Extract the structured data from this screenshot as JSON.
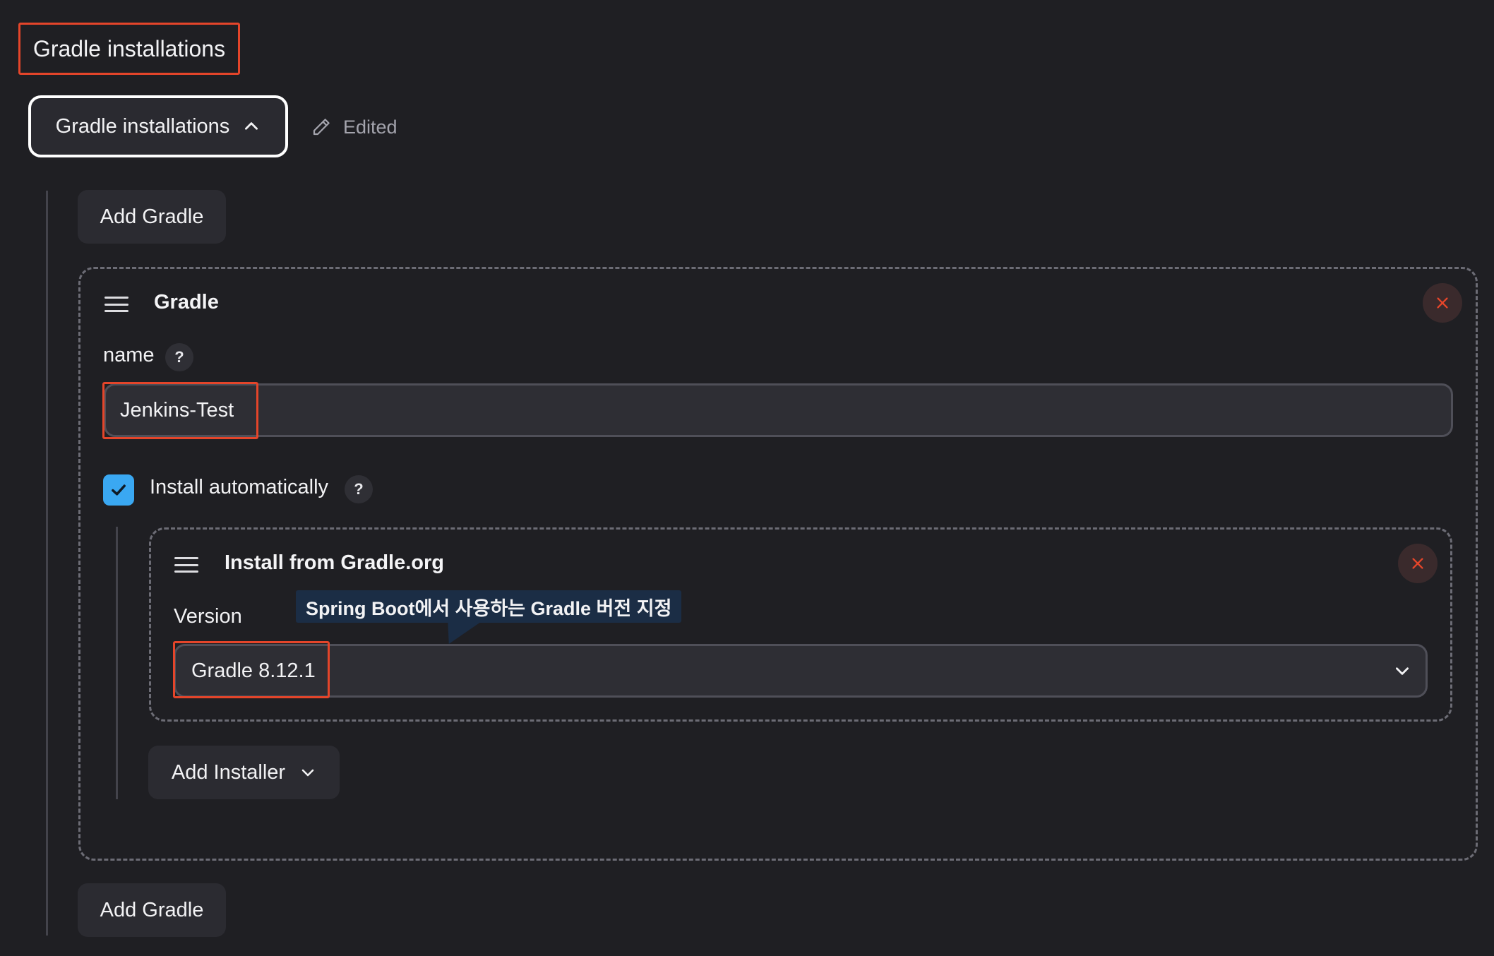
{
  "section": {
    "title": "Gradle installations"
  },
  "toggle": {
    "label": "Gradle installations",
    "icon": "chevron-up-icon"
  },
  "status": {
    "edited_label": "Edited",
    "icon": "pencil-icon"
  },
  "buttons": {
    "add_gradle_top": "Add Gradle",
    "add_gradle_bottom": "Add Gradle",
    "add_installer": "Add Installer"
  },
  "gradle_card": {
    "title": "Gradle",
    "name_label": "name",
    "name_help": "?",
    "name_value": "Jenkins-Test",
    "auto_install_label": "Install automatically",
    "auto_install_help": "?",
    "auto_install_checked": true
  },
  "installer_card": {
    "title": "Install from Gradle.org",
    "version_label": "Version",
    "version_value": "Gradle 8.12.1",
    "tooltip": "Spring Boot에서 사용하는 Gradle 버전 지정"
  },
  "colors": {
    "background": "#1f1f23",
    "highlight": "#e4452a",
    "checkbox": "#3aa8f2",
    "close": "#e4452a",
    "tooltip_bg": "#1b2d45"
  }
}
